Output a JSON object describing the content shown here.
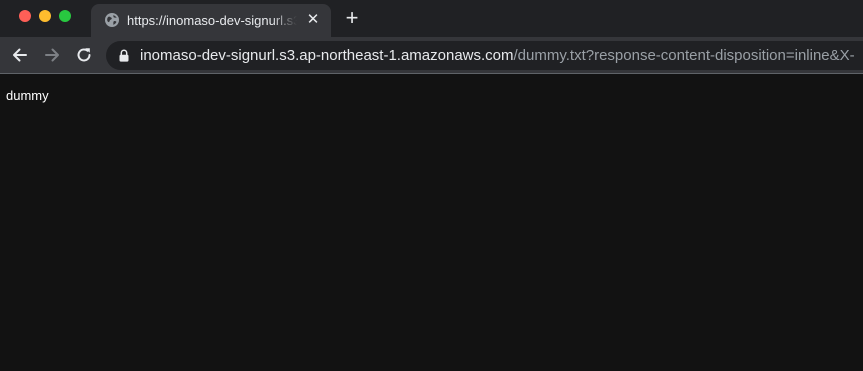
{
  "window": {
    "controls": [
      "close",
      "minimize",
      "maximize"
    ]
  },
  "tab": {
    "title": "https://inomaso-dev-signurl.s3.",
    "favicon": "globe-icon",
    "close_glyph": "✕"
  },
  "new_tab": {
    "glyph": "+"
  },
  "toolbar": {
    "back_icon": "arrow-left-icon",
    "forward_icon": "arrow-right-icon",
    "reload_icon": "reload-icon"
  },
  "omnibox": {
    "security_icon": "lock-icon",
    "url_host": "inomaso-dev-signurl.s3.ap-northeast-1.amazonaws.com",
    "url_path": "/dummy.txt?response-content-disposition=inline&X-"
  },
  "page": {
    "body_text": "dummy"
  },
  "colors": {
    "tabstrip_bg": "#202124",
    "toolbar_bg": "#35363a",
    "page_bg": "#121212",
    "url_host": "#e8eaed",
    "url_path": "#9aa0a6"
  }
}
